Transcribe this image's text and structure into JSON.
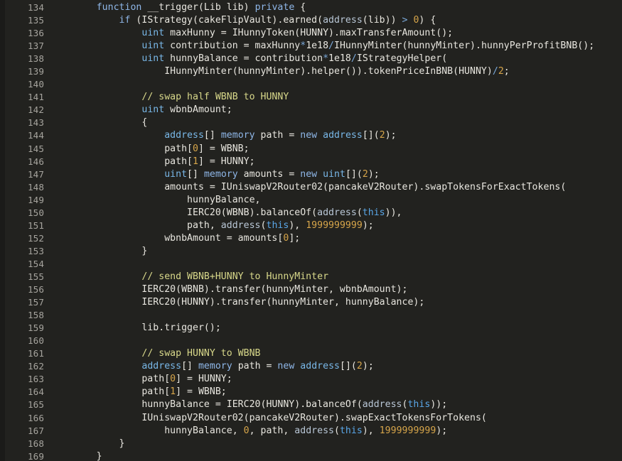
{
  "editor": {
    "language": "Solidity",
    "background_color": "#22221f",
    "foreground_color": "#e8e6df",
    "gutter_color": "#a6a49e",
    "first_line_number": 134,
    "last_line_number": 169,
    "colors": {
      "keyword": "#8fb7e8",
      "type": "#79b8e8",
      "comment": "#d8d88a",
      "number": "#d6a54a",
      "builtin": "#b9c7d6",
      "this": "#5aa7e8",
      "operator": "#7aa8d8"
    }
  },
  "lines": [
    {
      "number": "134",
      "tokens": [
        {
          "t": "        ",
          "c": "plain"
        },
        {
          "t": "function",
          "c": "keyword"
        },
        {
          "t": " __trigger(Lib lib) ",
          "c": "plain"
        },
        {
          "t": "private",
          "c": "keyword"
        },
        {
          "t": " {",
          "c": "plain"
        }
      ]
    },
    {
      "number": "135",
      "tokens": [
        {
          "t": "            ",
          "c": "plain"
        },
        {
          "t": "if",
          "c": "keyword"
        },
        {
          "t": " (IStrategy(cakeFlipVault).earned(",
          "c": "plain"
        },
        {
          "t": "address",
          "c": "builtin"
        },
        {
          "t": "(lib)) ",
          "c": "plain"
        },
        {
          "t": ">",
          "c": "op"
        },
        {
          "t": " ",
          "c": "plain"
        },
        {
          "t": "0",
          "c": "number"
        },
        {
          "t": ") {",
          "c": "plain"
        }
      ]
    },
    {
      "number": "136",
      "tokens": [
        {
          "t": "                ",
          "c": "plain"
        },
        {
          "t": "uint",
          "c": "type"
        },
        {
          "t": " maxHunny = IHunnyToken(HUNNY).maxTransferAmount();",
          "c": "plain"
        }
      ]
    },
    {
      "number": "137",
      "tokens": [
        {
          "t": "                ",
          "c": "plain"
        },
        {
          "t": "uint",
          "c": "type"
        },
        {
          "t": " contribution = maxHunny",
          "c": "plain"
        },
        {
          "t": "*",
          "c": "op"
        },
        {
          "t": "1e18",
          "c": "plain"
        },
        {
          "t": "/",
          "c": "op"
        },
        {
          "t": "IHunnyMinter(hunnyMinter).hunnyPerProfitBNB();",
          "c": "plain"
        }
      ]
    },
    {
      "number": "138",
      "tokens": [
        {
          "t": "                ",
          "c": "plain"
        },
        {
          "t": "uint",
          "c": "type"
        },
        {
          "t": " hunnyBalance = contribution",
          "c": "plain"
        },
        {
          "t": "*",
          "c": "op"
        },
        {
          "t": "1e18",
          "c": "plain"
        },
        {
          "t": "/",
          "c": "op"
        },
        {
          "t": "IStrategyHelper(",
          "c": "plain"
        }
      ]
    },
    {
      "number": "139",
      "tokens": [
        {
          "t": "                    IHunnyMinter(hunnyMinter).helper()).tokenPriceInBNB(HUNNY)",
          "c": "plain"
        },
        {
          "t": "/",
          "c": "op"
        },
        {
          "t": "2",
          "c": "number"
        },
        {
          "t": ";",
          "c": "plain"
        }
      ]
    },
    {
      "number": "140",
      "tokens": []
    },
    {
      "number": "141",
      "tokens": [
        {
          "t": "                ",
          "c": "plain"
        },
        {
          "t": "// swap half WBNB to HUNNY",
          "c": "comment"
        }
      ]
    },
    {
      "number": "142",
      "tokens": [
        {
          "t": "                ",
          "c": "plain"
        },
        {
          "t": "uint",
          "c": "type"
        },
        {
          "t": " wbnbAmount;",
          "c": "plain"
        }
      ]
    },
    {
      "number": "143",
      "tokens": [
        {
          "t": "                {",
          "c": "plain"
        }
      ]
    },
    {
      "number": "144",
      "tokens": [
        {
          "t": "                    ",
          "c": "plain"
        },
        {
          "t": "address",
          "c": "type"
        },
        {
          "t": "[] ",
          "c": "plain"
        },
        {
          "t": "memory",
          "c": "keyword"
        },
        {
          "t": " path = ",
          "c": "plain"
        },
        {
          "t": "new",
          "c": "keyword"
        },
        {
          "t": " ",
          "c": "plain"
        },
        {
          "t": "address",
          "c": "type"
        },
        {
          "t": "[](",
          "c": "plain"
        },
        {
          "t": "2",
          "c": "number"
        },
        {
          "t": ");",
          "c": "plain"
        }
      ]
    },
    {
      "number": "145",
      "tokens": [
        {
          "t": "                    path[",
          "c": "plain"
        },
        {
          "t": "0",
          "c": "number"
        },
        {
          "t": "] = WBNB;",
          "c": "plain"
        }
      ]
    },
    {
      "number": "146",
      "tokens": [
        {
          "t": "                    path[",
          "c": "plain"
        },
        {
          "t": "1",
          "c": "number"
        },
        {
          "t": "] = HUNNY;",
          "c": "plain"
        }
      ]
    },
    {
      "number": "147",
      "tokens": [
        {
          "t": "                    ",
          "c": "plain"
        },
        {
          "t": "uint",
          "c": "type"
        },
        {
          "t": "[] ",
          "c": "plain"
        },
        {
          "t": "memory",
          "c": "keyword"
        },
        {
          "t": " amounts = ",
          "c": "plain"
        },
        {
          "t": "new",
          "c": "keyword"
        },
        {
          "t": " ",
          "c": "plain"
        },
        {
          "t": "uint",
          "c": "type"
        },
        {
          "t": "[](",
          "c": "plain"
        },
        {
          "t": "2",
          "c": "number"
        },
        {
          "t": ");",
          "c": "plain"
        }
      ]
    },
    {
      "number": "148",
      "tokens": [
        {
          "t": "                    amounts = IUniswapV2Router02(pancakeV2Router).swapTokensForExactTokens(",
          "c": "plain"
        }
      ]
    },
    {
      "number": "149",
      "tokens": [
        {
          "t": "                        hunnyBalance,",
          "c": "plain"
        }
      ]
    },
    {
      "number": "150",
      "tokens": [
        {
          "t": "                        IERC20(WBNB).balanceOf(",
          "c": "plain"
        },
        {
          "t": "address",
          "c": "builtin"
        },
        {
          "t": "(",
          "c": "plain"
        },
        {
          "t": "this",
          "c": "this"
        },
        {
          "t": ")),",
          "c": "plain"
        }
      ]
    },
    {
      "number": "151",
      "tokens": [
        {
          "t": "                        path, ",
          "c": "plain"
        },
        {
          "t": "address",
          "c": "builtin"
        },
        {
          "t": "(",
          "c": "plain"
        },
        {
          "t": "this",
          "c": "this"
        },
        {
          "t": "), ",
          "c": "plain"
        },
        {
          "t": "1999999999",
          "c": "number"
        },
        {
          "t": ");",
          "c": "plain"
        }
      ]
    },
    {
      "number": "152",
      "tokens": [
        {
          "t": "                    wbnbAmount = amounts[",
          "c": "plain"
        },
        {
          "t": "0",
          "c": "number"
        },
        {
          "t": "];",
          "c": "plain"
        }
      ]
    },
    {
      "number": "153",
      "tokens": [
        {
          "t": "                }",
          "c": "plain"
        }
      ]
    },
    {
      "number": "154",
      "tokens": []
    },
    {
      "number": "155",
      "tokens": [
        {
          "t": "                ",
          "c": "plain"
        },
        {
          "t": "// send WBNB+HUNNY to HunnyMinter",
          "c": "comment"
        }
      ]
    },
    {
      "number": "156",
      "tokens": [
        {
          "t": "                IERC20(WBNB).transfer(hunnyMinter, wbnbAmount);",
          "c": "plain"
        }
      ]
    },
    {
      "number": "157",
      "tokens": [
        {
          "t": "                IERC20(HUNNY).transfer(hunnyMinter, hunnyBalance);",
          "c": "plain"
        }
      ]
    },
    {
      "number": "158",
      "tokens": []
    },
    {
      "number": "159",
      "tokens": [
        {
          "t": "                lib.trigger();",
          "c": "plain"
        }
      ]
    },
    {
      "number": "160",
      "tokens": []
    },
    {
      "number": "161",
      "tokens": [
        {
          "t": "                ",
          "c": "plain"
        },
        {
          "t": "// swap HUNNY to WBNB",
          "c": "comment"
        }
      ]
    },
    {
      "number": "162",
      "tokens": [
        {
          "t": "                ",
          "c": "plain"
        },
        {
          "t": "address",
          "c": "type"
        },
        {
          "t": "[] ",
          "c": "plain"
        },
        {
          "t": "memory",
          "c": "keyword"
        },
        {
          "t": " path = ",
          "c": "plain"
        },
        {
          "t": "new",
          "c": "keyword"
        },
        {
          "t": " ",
          "c": "plain"
        },
        {
          "t": "address",
          "c": "type"
        },
        {
          "t": "[](",
          "c": "plain"
        },
        {
          "t": "2",
          "c": "number"
        },
        {
          "t": ");",
          "c": "plain"
        }
      ]
    },
    {
      "number": "163",
      "tokens": [
        {
          "t": "                path[",
          "c": "plain"
        },
        {
          "t": "0",
          "c": "number"
        },
        {
          "t": "] = HUNNY;",
          "c": "plain"
        }
      ]
    },
    {
      "number": "164",
      "tokens": [
        {
          "t": "                path[",
          "c": "plain"
        },
        {
          "t": "1",
          "c": "number"
        },
        {
          "t": "] = WBNB;",
          "c": "plain"
        }
      ]
    },
    {
      "number": "165",
      "tokens": [
        {
          "t": "                hunnyBalance = IERC20(HUNNY).balanceOf(",
          "c": "plain"
        },
        {
          "t": "address",
          "c": "builtin"
        },
        {
          "t": "(",
          "c": "plain"
        },
        {
          "t": "this",
          "c": "this"
        },
        {
          "t": "));",
          "c": "plain"
        }
      ]
    },
    {
      "number": "166",
      "tokens": [
        {
          "t": "                IUniswapV2Router02(pancakeV2Router).swapExactTokensForTokens(",
          "c": "plain"
        }
      ]
    },
    {
      "number": "167",
      "tokens": [
        {
          "t": "                    hunnyBalance, ",
          "c": "plain"
        },
        {
          "t": "0",
          "c": "number"
        },
        {
          "t": ", path, ",
          "c": "plain"
        },
        {
          "t": "address",
          "c": "builtin"
        },
        {
          "t": "(",
          "c": "plain"
        },
        {
          "t": "this",
          "c": "this"
        },
        {
          "t": "), ",
          "c": "plain"
        },
        {
          "t": "1999999999",
          "c": "number"
        },
        {
          "t": ");",
          "c": "plain"
        }
      ]
    },
    {
      "number": "168",
      "tokens": [
        {
          "t": "            }",
          "c": "plain"
        }
      ]
    },
    {
      "number": "169",
      "tokens": [
        {
          "t": "        }",
          "c": "plain"
        }
      ]
    }
  ]
}
